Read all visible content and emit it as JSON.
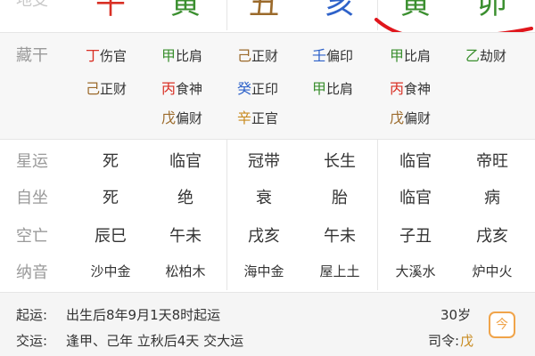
{
  "header": {
    "row_label": "地支",
    "chars": [
      {
        "t": "午",
        "color": "#d93025"
      },
      {
        "t": "寅",
        "color": "#3b8f2f"
      },
      {
        "t": "丑",
        "color": "#9b6a2b"
      },
      {
        "t": "亥",
        "color": "#2e62c9"
      },
      {
        "t": "寅",
        "color": "#3b8f2f"
      },
      {
        "t": "卯",
        "color": "#3b8f2f"
      }
    ]
  },
  "canggan": {
    "label": "藏干",
    "cols": [
      [
        {
          "g": "丁",
          "gc": "#d93025",
          "s": "伤官"
        },
        {
          "g": "己",
          "gc": "#9b6a2b",
          "s": "正财"
        }
      ],
      [
        {
          "g": "甲",
          "gc": "#3b8f2f",
          "s": "比肩"
        },
        {
          "g": "丙",
          "gc": "#d93025",
          "s": "食神"
        },
        {
          "g": "戊",
          "gc": "#9b6a2b",
          "s": "偏财"
        }
      ],
      [
        {
          "g": "己",
          "gc": "#9b6a2b",
          "s": "正财"
        },
        {
          "g": "癸",
          "gc": "#2e62c9",
          "s": "正印"
        },
        {
          "g": "辛",
          "gc": "#c88a1e",
          "s": "正官"
        }
      ],
      [
        {
          "g": "壬",
          "gc": "#2e62c9",
          "s": "偏印"
        },
        {
          "g": "甲",
          "gc": "#3b8f2f",
          "s": "比肩"
        }
      ],
      [
        {
          "g": "甲",
          "gc": "#3b8f2f",
          "s": "比肩"
        },
        {
          "g": "丙",
          "gc": "#d93025",
          "s": "食神"
        },
        {
          "g": "戊",
          "gc": "#9b6a2b",
          "s": "偏财"
        }
      ],
      [
        {
          "g": "乙",
          "gc": "#3b8f2f",
          "s": "劫财"
        }
      ]
    ]
  },
  "rows": [
    {
      "label": "星运",
      "values": [
        "死",
        "临官",
        "冠带",
        "长生",
        "临官",
        "帝旺"
      ]
    },
    {
      "label": "自坐",
      "values": [
        "死",
        "绝",
        "衰",
        "胎",
        "临官",
        "病"
      ]
    },
    {
      "label": "空亡",
      "values": [
        "辰巳",
        "午未",
        "戌亥",
        "午未",
        "子丑",
        "戌亥"
      ]
    },
    {
      "label": "纳音",
      "values": [
        "沙中金",
        "松柏木",
        "海中金",
        "屋上土",
        "大溪水",
        "炉中火"
      ]
    }
  ],
  "footer": {
    "qiyun_label": "起运:",
    "qiyun_text": "出生后8年9月1天8时起运",
    "age": "30岁",
    "jiaoyun_label": "交运:",
    "jiaoyun_text": "逢甲、己年 立秋后4天 交大运",
    "siling_label": "司令:",
    "siling_value": "戊",
    "siling_color": "#c88a1e",
    "icon_char": "今"
  }
}
